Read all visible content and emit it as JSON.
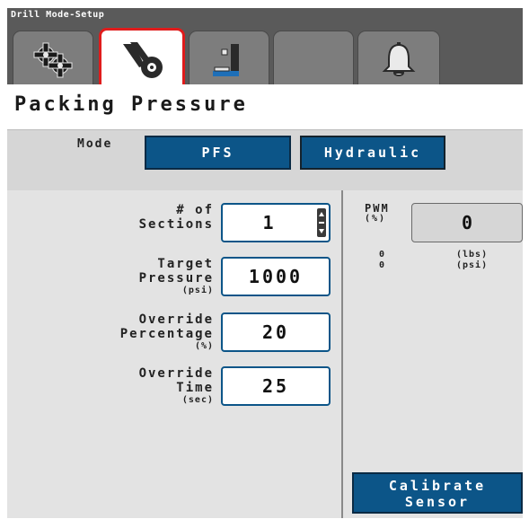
{
  "app": {
    "title": "Drill Mode-Setup"
  },
  "tabs": [
    {
      "icon": "gear-icon",
      "active": false
    },
    {
      "icon": "packer-wheel-icon",
      "active": true
    },
    {
      "icon": "opener-icon",
      "active": false
    },
    {
      "icon": "",
      "active": false
    },
    {
      "icon": "bell-icon",
      "active": false
    }
  ],
  "header": {
    "title": "Packing Pressure"
  },
  "mode": {
    "label": "Mode",
    "options": [
      "PFS",
      "Hydraulic"
    ]
  },
  "fields": {
    "sections": {
      "label_line1": "# of",
      "label_line2": "Sections",
      "value": "1"
    },
    "target_pressure": {
      "label_line1": "Target",
      "label_line2": "Pressure",
      "unit": "(psi)",
      "value": "1000"
    },
    "override_percentage": {
      "label_line1": "Override",
      "label_line2": "Percentage",
      "unit": "(%)",
      "value": "20"
    },
    "override_time": {
      "label_line1": "Override",
      "label_line2": "Time",
      "unit": "(sec)",
      "value": "25"
    }
  },
  "pwm": {
    "label": "PWM",
    "unit": "(%)",
    "value": "0",
    "readings": [
      {
        "value": "0",
        "unit": "(lbs)"
      },
      {
        "value": "0",
        "unit": "(psi)"
      }
    ]
  },
  "calibrate": {
    "line1": "Calibrate",
    "line2": "Sensor"
  },
  "colors": {
    "accent": "#0c5588",
    "active_tab_border": "#e01c1c",
    "titlebar": "#5a5a5a",
    "panel": "#e3e3e3"
  }
}
